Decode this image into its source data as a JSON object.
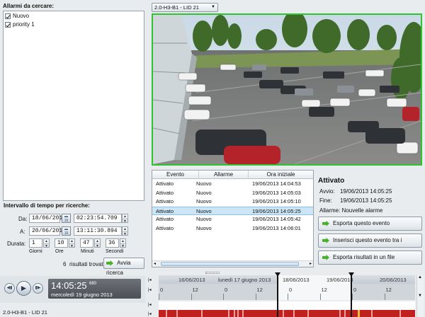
{
  "search": {
    "alarms_title": "Allarmi da cercare:",
    "alarm_items": [
      {
        "label": "Nuovo",
        "checked": true
      },
      {
        "label": "priority 1",
        "checked": true
      }
    ],
    "interval_title": "Intervallo di tempo per ricerche:",
    "from_label": "Da:",
    "from_date": "18/06/2013",
    "from_time": "02:23:54.709",
    "to_label": "A:",
    "to_date": "20/06/2013",
    "to_time": "13:11:30.894",
    "duration_label": "Durata:",
    "duration": [
      {
        "value": "1",
        "unit": "Giorni"
      },
      {
        "value": "10",
        "unit": "Ore"
      },
      {
        "value": "47",
        "unit": "Minuti"
      },
      {
        "value": "36",
        "unit": "Secondi"
      }
    ],
    "results_count": "6",
    "results_text": "risultati trovati",
    "start_search_label": "Avvia ricerca"
  },
  "camera": {
    "selected": "2.0-H3-B1 - LID 21"
  },
  "results_table": {
    "headers": [
      "Evento",
      "Allarme",
      "Ora iniziale"
    ],
    "rows": [
      [
        "Attivato",
        "Nuovo",
        "19/06/2013 14:04:53"
      ],
      [
        "Attivato",
        "Nuovo",
        "19/06/2013 14:05:03"
      ],
      [
        "Attivato",
        "Nuovo",
        "19/06/2013 14:05:10"
      ],
      [
        "Attivato",
        "Nuovo",
        "19/06/2013 14:05:25"
      ],
      [
        "Attivato",
        "Nuovo",
        "19/06/2013 14:05:42"
      ],
      [
        "Attivato",
        "Nuovo",
        "19/06/2013 14:06:01"
      ]
    ],
    "selected_index": 3
  },
  "details": {
    "title": "Attivato",
    "from_label": "Avvio:",
    "from_value": "19/06/2013 14:05:25",
    "end_label": "Fine:",
    "end_value": "19/06/2013 14:05:25",
    "alarm_line": "Allarme: Nouvelle alarme",
    "actions": [
      "Esporta questo evento",
      "Inserisci questo evento tra i bookmark",
      "Esporta risultati in un file"
    ]
  },
  "playback": {
    "time": "14:05:25",
    "millis": "680",
    "date": "mercoledì 19 giugno 2013"
  },
  "timeline": {
    "date_labels": [
      "16/06/2013",
      "lunedì 17 giugno 2013",
      "18/06/2013",
      "19/06/2013",
      "20/06/2013"
    ],
    "hour_labels": [
      "0",
      "12",
      "0",
      "12",
      "0",
      "12",
      "0",
      "12",
      "0"
    ],
    "track_label": "2.0-H3-B1 - LID 21"
  },
  "colors": {
    "accent_green": "#4caf2a",
    "selection_blue": "#cce6f7",
    "recording_red": "#c0201e",
    "video_border": "#2fc42f"
  }
}
